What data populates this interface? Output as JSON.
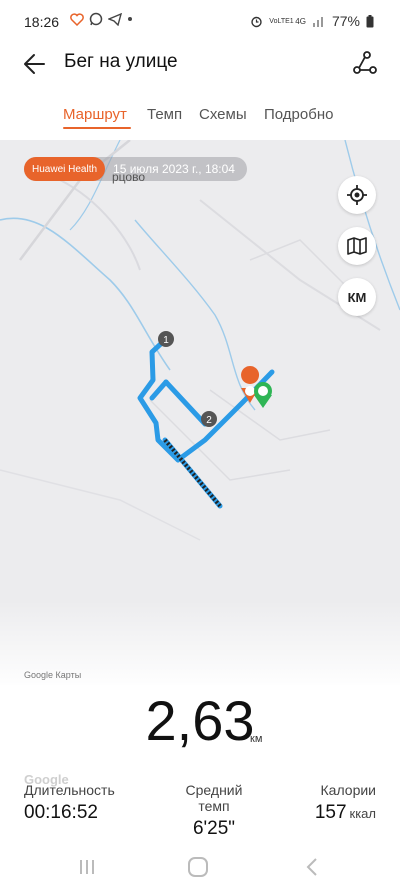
{
  "status_bar": {
    "time": "18:26",
    "left_icons": [
      "heart-rate-icon",
      "whatsapp-icon",
      "telegram-icon",
      "dot-icon"
    ],
    "network_label": "VoLTE1",
    "network_type": "4G",
    "battery": "77%"
  },
  "header": {
    "title": "Бег на улице",
    "back_icon": "arrow-left-icon",
    "route_icon": "route-share-icon"
  },
  "tabs": [
    {
      "label": "Маршрут",
      "active": true
    },
    {
      "label": "Темп",
      "active": false
    },
    {
      "label": "Схемы",
      "active": false
    },
    {
      "label": "Подробно",
      "active": false
    }
  ],
  "map": {
    "brand_badge": "Huawei Health",
    "date_time": "15 июля 2023 г., 18:04",
    "village_label": "рцово",
    "km_marker_1": "1",
    "km_marker_2": "2",
    "unit_toggle": "КМ",
    "attribution": "Google Карты",
    "watermark": "Google",
    "route_color": "#2b9be6",
    "start_marker_color": "#2fb555",
    "end_marker_color": "#e8642b"
  },
  "summary": {
    "distance_value": "2,63",
    "distance_unit": "км"
  },
  "stats": [
    {
      "label": "Длительность",
      "value": "00:16:52",
      "unit": ""
    },
    {
      "label": "Средний темп",
      "value": "6'25\"",
      "unit": ""
    },
    {
      "label": "Калории",
      "value": "157",
      "unit": "ккал"
    }
  ],
  "nav": {
    "recents_icon": "recents-icon",
    "home_icon": "home-icon",
    "back_icon": "back-chevron-icon"
  }
}
